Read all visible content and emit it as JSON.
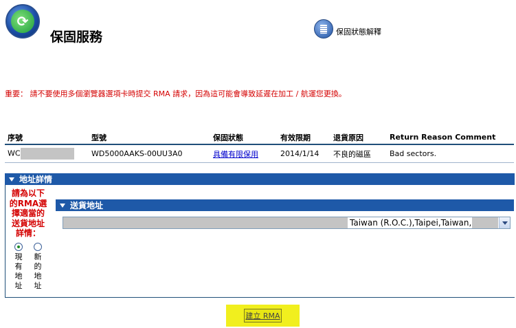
{
  "header": {
    "title": "保固服務",
    "help_link_label": "保固狀態解釋"
  },
  "notice": "重要： 請不要使用多個瀏覽器選項卡時提交 RMA 請求，因為這可能會導致延遲在加工 / 航運您更換。",
  "table": {
    "columns": [
      "序號",
      "型號",
      "保固狀態",
      "有效限期",
      "退貨原因",
      "Return Reason Comment"
    ],
    "rows": [
      {
        "serial_prefix": "WC",
        "model": "WD5000AAKS-00UU3A0",
        "warranty_status": "具備有限保用",
        "expiry": "2014/1/14",
        "return_reason": "不良的磁區",
        "comment": "Bad sectors."
      }
    ]
  },
  "address_section": {
    "title": "地址詳情",
    "instruction": "請為以下的RMA選擇適當的送貨地址詳情：",
    "options": [
      {
        "label": "現有地址",
        "checked": true
      },
      {
        "label": "新的地址",
        "checked": false
      }
    ]
  },
  "shipping": {
    "title": "送貨地址",
    "selected_address_visible": "Taiwan (R.O.C.),Taipei,Taiwan,"
  },
  "actions": {
    "create_rma": "建立 RMA"
  },
  "colors": {
    "section_bar": "#1e59a8",
    "notice_red": "#d40000",
    "highlight_yellow": "#f1ef1e"
  }
}
